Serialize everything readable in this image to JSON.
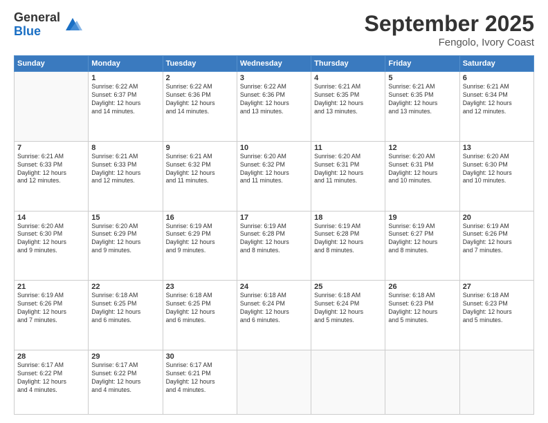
{
  "logo": {
    "general": "General",
    "blue": "Blue"
  },
  "title": "September 2025",
  "location": "Fengolo, Ivory Coast",
  "days_header": [
    "Sunday",
    "Monday",
    "Tuesday",
    "Wednesday",
    "Thursday",
    "Friday",
    "Saturday"
  ],
  "weeks": [
    [
      {
        "num": "",
        "info": ""
      },
      {
        "num": "1",
        "info": "Sunrise: 6:22 AM\nSunset: 6:37 PM\nDaylight: 12 hours\nand 14 minutes."
      },
      {
        "num": "2",
        "info": "Sunrise: 6:22 AM\nSunset: 6:36 PM\nDaylight: 12 hours\nand 14 minutes."
      },
      {
        "num": "3",
        "info": "Sunrise: 6:22 AM\nSunset: 6:36 PM\nDaylight: 12 hours\nand 13 minutes."
      },
      {
        "num": "4",
        "info": "Sunrise: 6:21 AM\nSunset: 6:35 PM\nDaylight: 12 hours\nand 13 minutes."
      },
      {
        "num": "5",
        "info": "Sunrise: 6:21 AM\nSunset: 6:35 PM\nDaylight: 12 hours\nand 13 minutes."
      },
      {
        "num": "6",
        "info": "Sunrise: 6:21 AM\nSunset: 6:34 PM\nDaylight: 12 hours\nand 12 minutes."
      }
    ],
    [
      {
        "num": "7",
        "info": "Sunrise: 6:21 AM\nSunset: 6:33 PM\nDaylight: 12 hours\nand 12 minutes."
      },
      {
        "num": "8",
        "info": "Sunrise: 6:21 AM\nSunset: 6:33 PM\nDaylight: 12 hours\nand 12 minutes."
      },
      {
        "num": "9",
        "info": "Sunrise: 6:21 AM\nSunset: 6:32 PM\nDaylight: 12 hours\nand 11 minutes."
      },
      {
        "num": "10",
        "info": "Sunrise: 6:20 AM\nSunset: 6:32 PM\nDaylight: 12 hours\nand 11 minutes."
      },
      {
        "num": "11",
        "info": "Sunrise: 6:20 AM\nSunset: 6:31 PM\nDaylight: 12 hours\nand 11 minutes."
      },
      {
        "num": "12",
        "info": "Sunrise: 6:20 AM\nSunset: 6:31 PM\nDaylight: 12 hours\nand 10 minutes."
      },
      {
        "num": "13",
        "info": "Sunrise: 6:20 AM\nSunset: 6:30 PM\nDaylight: 12 hours\nand 10 minutes."
      }
    ],
    [
      {
        "num": "14",
        "info": "Sunrise: 6:20 AM\nSunset: 6:30 PM\nDaylight: 12 hours\nand 9 minutes."
      },
      {
        "num": "15",
        "info": "Sunrise: 6:20 AM\nSunset: 6:29 PM\nDaylight: 12 hours\nand 9 minutes."
      },
      {
        "num": "16",
        "info": "Sunrise: 6:19 AM\nSunset: 6:29 PM\nDaylight: 12 hours\nand 9 minutes."
      },
      {
        "num": "17",
        "info": "Sunrise: 6:19 AM\nSunset: 6:28 PM\nDaylight: 12 hours\nand 8 minutes."
      },
      {
        "num": "18",
        "info": "Sunrise: 6:19 AM\nSunset: 6:28 PM\nDaylight: 12 hours\nand 8 minutes."
      },
      {
        "num": "19",
        "info": "Sunrise: 6:19 AM\nSunset: 6:27 PM\nDaylight: 12 hours\nand 8 minutes."
      },
      {
        "num": "20",
        "info": "Sunrise: 6:19 AM\nSunset: 6:26 PM\nDaylight: 12 hours\nand 7 minutes."
      }
    ],
    [
      {
        "num": "21",
        "info": "Sunrise: 6:19 AM\nSunset: 6:26 PM\nDaylight: 12 hours\nand 7 minutes."
      },
      {
        "num": "22",
        "info": "Sunrise: 6:18 AM\nSunset: 6:25 PM\nDaylight: 12 hours\nand 6 minutes."
      },
      {
        "num": "23",
        "info": "Sunrise: 6:18 AM\nSunset: 6:25 PM\nDaylight: 12 hours\nand 6 minutes."
      },
      {
        "num": "24",
        "info": "Sunrise: 6:18 AM\nSunset: 6:24 PM\nDaylight: 12 hours\nand 6 minutes."
      },
      {
        "num": "25",
        "info": "Sunrise: 6:18 AM\nSunset: 6:24 PM\nDaylight: 12 hours\nand 5 minutes."
      },
      {
        "num": "26",
        "info": "Sunrise: 6:18 AM\nSunset: 6:23 PM\nDaylight: 12 hours\nand 5 minutes."
      },
      {
        "num": "27",
        "info": "Sunrise: 6:18 AM\nSunset: 6:23 PM\nDaylight: 12 hours\nand 5 minutes."
      }
    ],
    [
      {
        "num": "28",
        "info": "Sunrise: 6:17 AM\nSunset: 6:22 PM\nDaylight: 12 hours\nand 4 minutes."
      },
      {
        "num": "29",
        "info": "Sunrise: 6:17 AM\nSunset: 6:22 PM\nDaylight: 12 hours\nand 4 minutes."
      },
      {
        "num": "30",
        "info": "Sunrise: 6:17 AM\nSunset: 6:21 PM\nDaylight: 12 hours\nand 4 minutes."
      },
      {
        "num": "",
        "info": ""
      },
      {
        "num": "",
        "info": ""
      },
      {
        "num": "",
        "info": ""
      },
      {
        "num": "",
        "info": ""
      }
    ]
  ]
}
